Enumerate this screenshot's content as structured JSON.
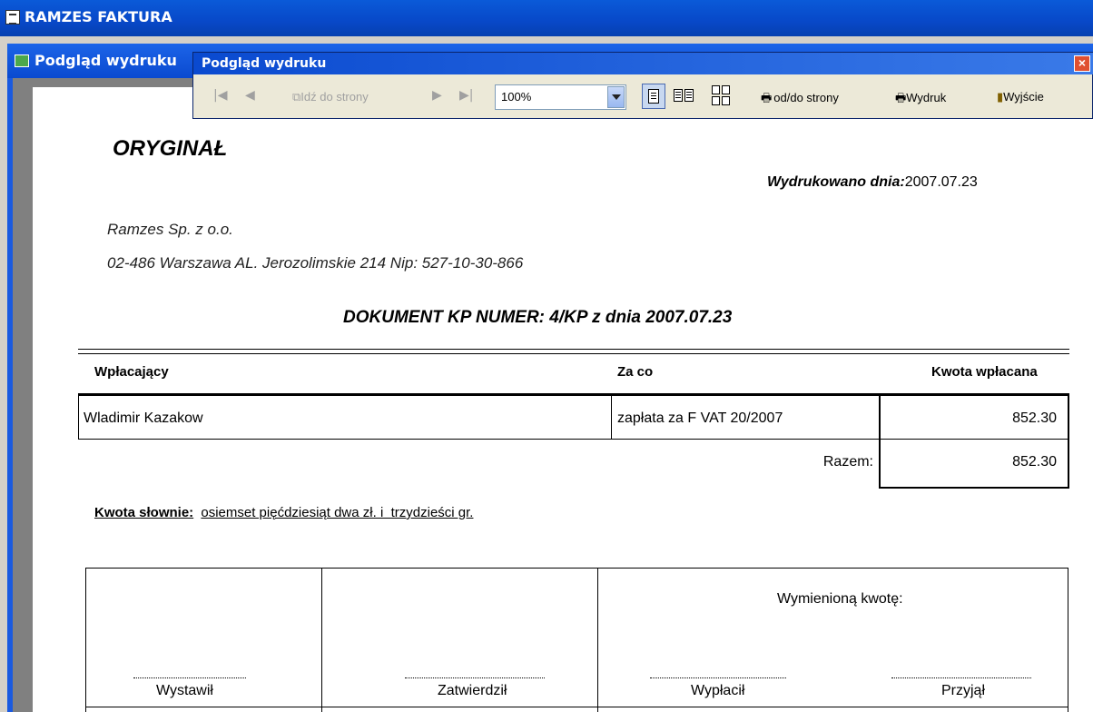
{
  "app": {
    "title": "RAMZES FAKTURA"
  },
  "mdi": {
    "title": "Podgląd wydruku"
  },
  "toolbar": {
    "title": "Podgląd wydruku",
    "goto_label": "Idź do strony",
    "zoom_value": "100%",
    "range_label": "od/do strony",
    "print_label": "Wydruk",
    "exit_label": "Wyjście"
  },
  "document": {
    "heading": "ORYGINAŁ",
    "printed_label": "Wydrukowano dnia:",
    "printed_date": "2007.07.23",
    "company_name": "Ramzes Sp. z o.o.",
    "company_address": "02-486 Warszawa AL. Jerozolimskie 214 Nip: 527-10-30-866",
    "doc_title": "DOKUMENT KP NUMER: 4/KP z dnia 2007.07.23",
    "table": {
      "headers": [
        "Wpłacający",
        "Za co",
        "Kwota wpłacana"
      ],
      "rows": [
        [
          "Wladimir Kazakow",
          "zapłata za F VAT 20/2007",
          "852.30"
        ]
      ],
      "total_label": "Razem:",
      "total_value": "852.30"
    },
    "amount_words_label": "Kwota słownie:",
    "amount_words": "osiemset pięćdziesiąt dwa zł. i  trzydzieści gr.",
    "signatures": {
      "amount_caption": "Wymienioną kwotę:",
      "issued": "Wystawił",
      "approved": "Zatwierdził",
      "paid_out": "Wypłacił",
      "received": "Przyjął"
    }
  },
  "colors": {
    "titlebar": "#0a4ad0",
    "toolbar_bg": "#ece9d8",
    "client_bg": "#808080",
    "close_button": "#e05030"
  }
}
